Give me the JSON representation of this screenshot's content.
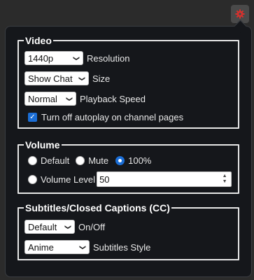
{
  "extension": {
    "icon": "gear-icon",
    "color": "#d9302c"
  },
  "video": {
    "legend": "Video",
    "resolution": {
      "value": "1440p",
      "label": "Resolution"
    },
    "chat": {
      "value": "Show Chat",
      "label": "Size"
    },
    "speed": {
      "value": "Normal",
      "label": "Playback Speed"
    },
    "autoplay": {
      "checked": true,
      "label": "Turn off autoplay on channel pages"
    }
  },
  "volume": {
    "legend": "Volume",
    "options": [
      {
        "label": "Default",
        "checked": false
      },
      {
        "label": "Mute",
        "checked": false
      },
      {
        "label": "100%",
        "checked": true
      }
    ],
    "level": {
      "label": "Volume Level",
      "value": "50"
    }
  },
  "subtitles": {
    "legend": "Subtitles/Closed Captions (CC)",
    "onoff": {
      "value": "Default",
      "label": "On/Off"
    },
    "style": {
      "value": "Anime",
      "label": "Subtitles Style"
    }
  },
  "colors": {
    "accent": "#1b6ed6",
    "panel": "#15171b",
    "border": "#e6e6e6"
  }
}
